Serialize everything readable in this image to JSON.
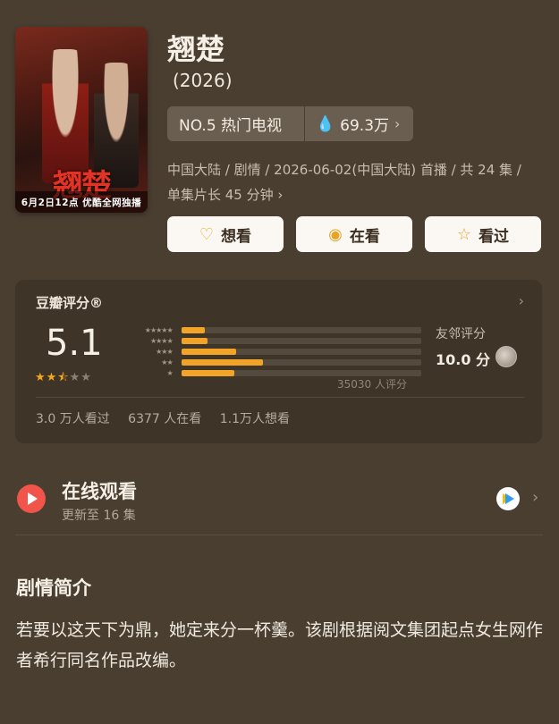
{
  "poster": {
    "title_art": "翘楚",
    "banner": "6月2日12点 优酷全网独播"
  },
  "show": {
    "title": "翘楚",
    "year": "(2026)",
    "rank": "NO.5 热门电视",
    "heat": "69.3万",
    "meta": "中国大陆 / 剧情 / 2026-06-02(中国大陆) 首播 / 共 24 集 / 单集片长 45 分钟 ›"
  },
  "actions": [
    {
      "label": "想看",
      "icon": "heart-plus-icon"
    },
    {
      "label": "在看",
      "icon": "target-icon"
    },
    {
      "label": "看过",
      "icon": "star-icon"
    }
  ],
  "rating": {
    "title": "豆瓣评分®",
    "score": "5.1",
    "stars_value": 2.5,
    "distribution": [
      {
        "stars": "★★★★★",
        "fraction": 0.1
      },
      {
        "stars": "★★★★",
        "fraction": 0.11
      },
      {
        "stars": "★★★",
        "fraction": 0.23
      },
      {
        "stars": "★★",
        "fraction": 0.34
      },
      {
        "stars": "★",
        "fraction": 0.22
      }
    ],
    "votes": "35030 人评分",
    "friend_label": "友邻评分",
    "friend_score": "10.0 分",
    "stats": [
      "3.0 万人看过",
      "6377 人在看",
      "1.1万人想看"
    ]
  },
  "online": {
    "title": "在线观看",
    "subtitle": "更新至 16 集",
    "platform_icon": "youku-icon"
  },
  "intro": {
    "heading": "剧情简介",
    "body": "若要以这天下为鼎，她定来分一杯羹。该剧根据阅文集团起点女生网作者希行同名作品改编。"
  },
  "colors": {
    "background": "#4a3e31",
    "accent": "#f2a429",
    "play": "#f0544a"
  }
}
